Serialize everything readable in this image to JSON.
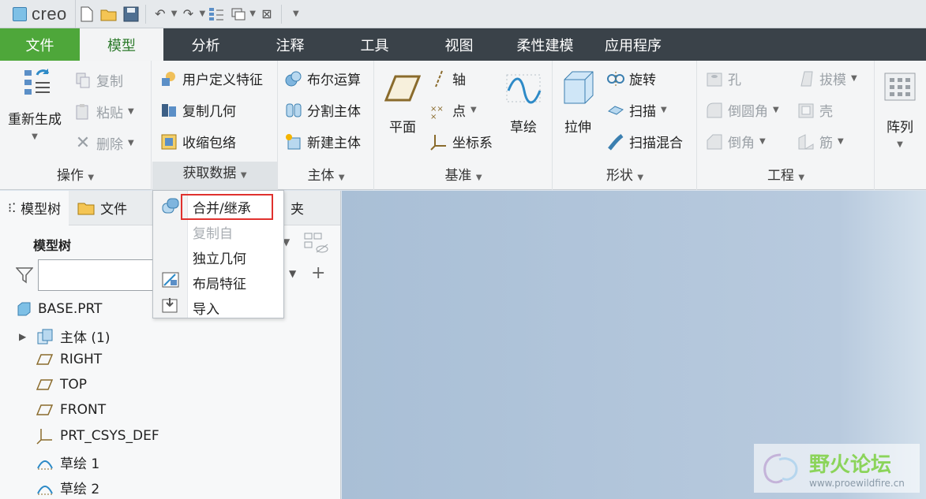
{
  "app": {
    "logo": "creo"
  },
  "tabs": [
    "文件",
    "模型",
    "分析",
    "注释",
    "工具",
    "视图",
    "柔性建模",
    "应用程序"
  ],
  "ribbon": {
    "operations": {
      "label": "操作",
      "regenerate": "重新生成",
      "copy": "复制",
      "paste": "粘贴",
      "delete": "删除"
    },
    "get_data": {
      "label": "获取数据",
      "udf": "用户定义特征",
      "copy_geom": "复制几何",
      "shrinkwrap": "收缩包络"
    },
    "body": {
      "label": "主体",
      "boolean": "布尔运算",
      "split": "分割主体",
      "new_body": "新建主体"
    },
    "datum": {
      "label": "基准",
      "plane": "平面",
      "axis": "轴",
      "point": "点",
      "csys": "坐标系",
      "sketch": "草绘"
    },
    "shapes": {
      "label": "形状",
      "extrude": "拉伸",
      "revolve": "旋转",
      "sweep": "扫描",
      "swept_blend": "扫描混合"
    },
    "engineering": {
      "label": "工程",
      "hole": "孔",
      "round": "倒圆角",
      "chamfer": "倒角",
      "draft": "拔模",
      "shell": "壳",
      "rib": "筋"
    },
    "pattern": {
      "label": "阵列"
    }
  },
  "menu": {
    "items": [
      {
        "label": "合并/继承",
        "state": "selected"
      },
      {
        "label": "复制自",
        "state": "disabled"
      },
      {
        "label": "独立几何",
        "state": "normal"
      },
      {
        "label": "布局特征",
        "state": "normal"
      },
      {
        "label": "导入",
        "state": "normal"
      }
    ]
  },
  "panel": {
    "tabs": {
      "model_tree": "模型树",
      "files": "文件",
      "favorites": "夹"
    },
    "title": "模型树",
    "search_value": "",
    "tree": [
      {
        "label": "BASE.PRT",
        "icon": "part-icon"
      },
      {
        "label": "主体 (1)",
        "icon": "body-icon"
      },
      {
        "label": "RIGHT",
        "icon": "datum-plane-icon"
      },
      {
        "label": "TOP",
        "icon": "datum-plane-icon"
      },
      {
        "label": "FRONT",
        "icon": "datum-plane-icon"
      },
      {
        "label": "PRT_CSYS_DEF",
        "icon": "csys-icon"
      },
      {
        "label": "草绘 1",
        "icon": "sketch-icon"
      },
      {
        "label": "草绘 2",
        "icon": "sketch-icon"
      }
    ]
  },
  "watermark": {
    "title": "野火论坛",
    "url": "www.proewildfire.cn"
  },
  "colors": {
    "file_tab": "#4ea73a",
    "tab_bar": "#3a4249",
    "active_tab_text": "#2c7a2b",
    "highlight": "#e0312e"
  }
}
